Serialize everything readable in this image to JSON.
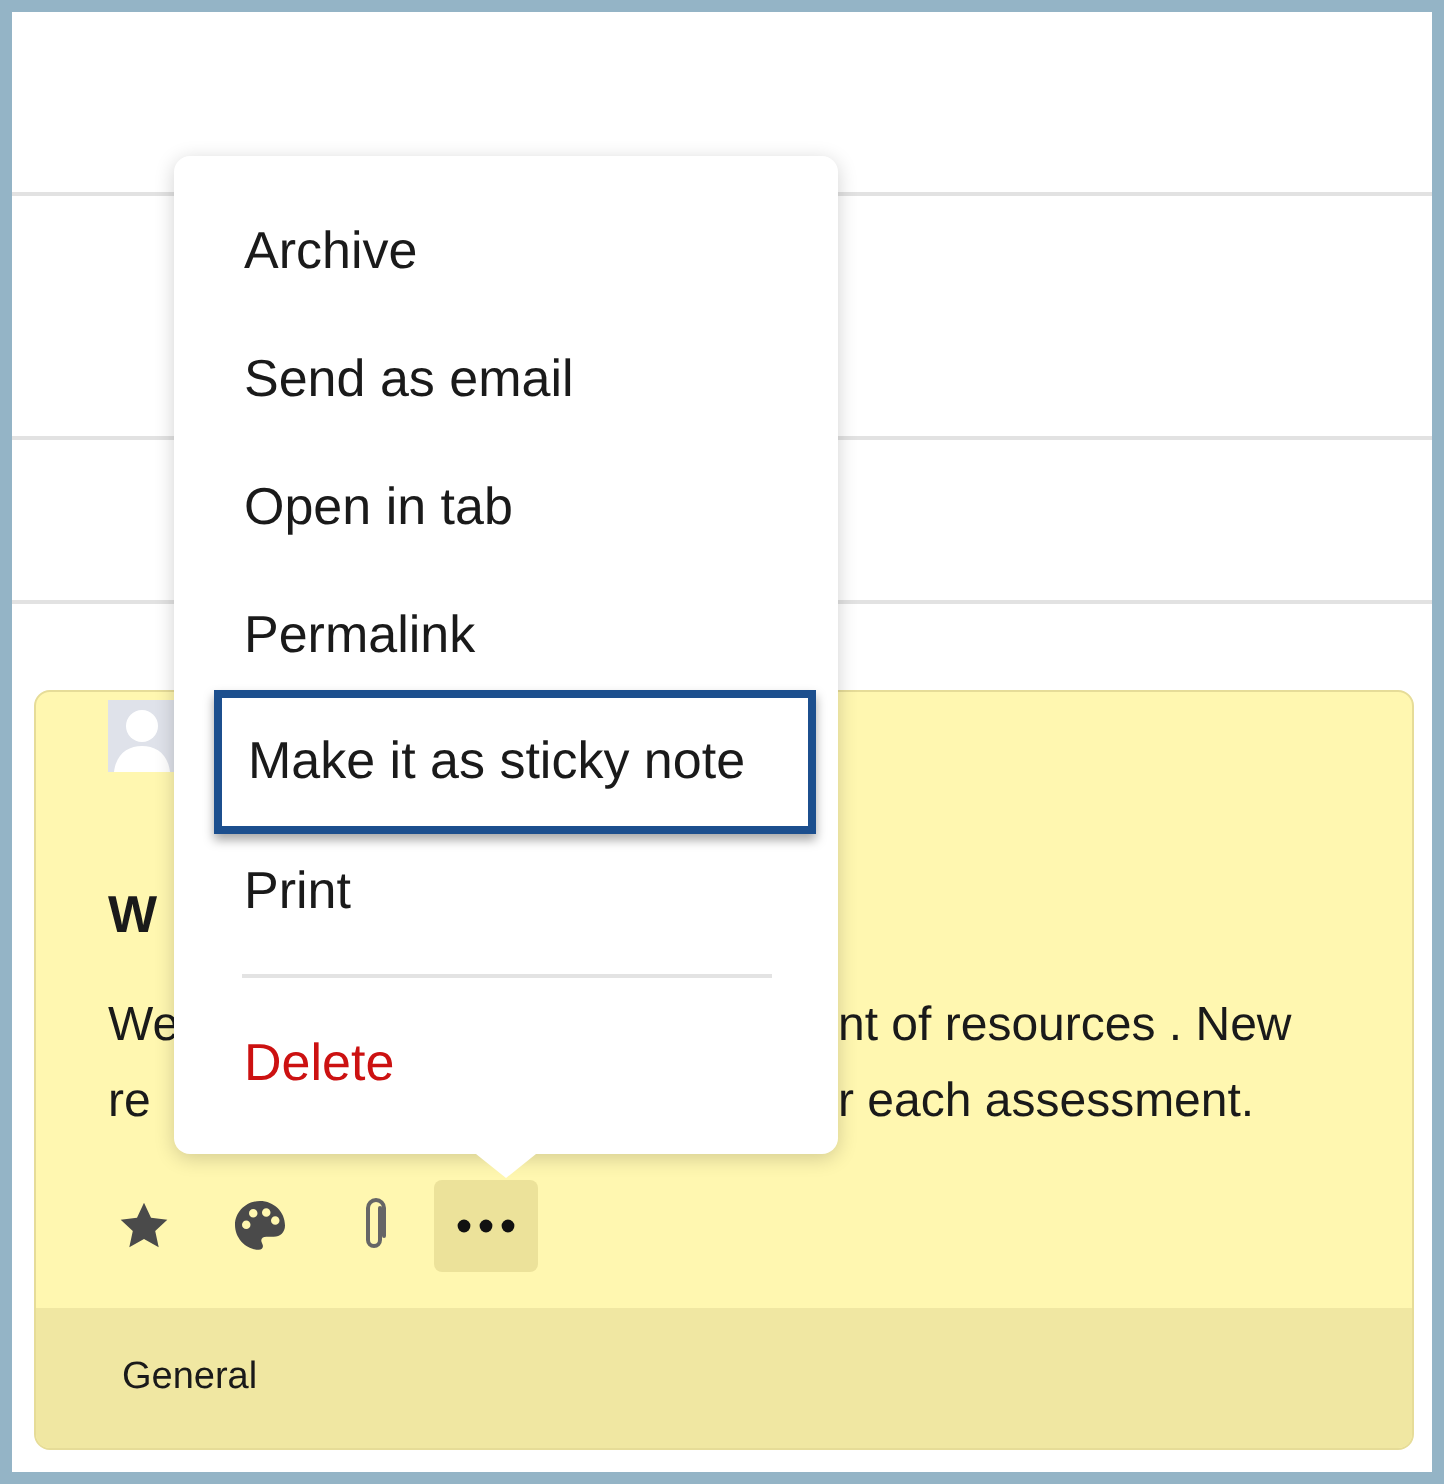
{
  "note": {
    "title": "W",
    "body_lines": [
      {
        "left": "We",
        "right": "nt of resources . New"
      },
      {
        "left": "re",
        "right": "r each assessment."
      }
    ],
    "actions": [
      {
        "kind": "star",
        "active": false
      },
      {
        "kind": "palette",
        "active": false
      },
      {
        "kind": "attach",
        "active": false
      },
      {
        "kind": "more",
        "active": true
      }
    ],
    "category": "General"
  },
  "menu": {
    "items": [
      {
        "kind": "normal",
        "label": "Archive",
        "selected": false
      },
      {
        "kind": "normal",
        "label": "Send as email",
        "selected": false
      },
      {
        "kind": "normal",
        "label": "Open in tab",
        "selected": false
      },
      {
        "kind": "normal",
        "label": "Permalink",
        "selected": false
      },
      {
        "kind": "normal",
        "label": "Make it as sticky note",
        "selected": true
      },
      {
        "kind": "normal",
        "label": "Print",
        "selected": false
      },
      {
        "kind": "separator"
      },
      {
        "kind": "danger",
        "label": "Delete",
        "selected": false
      }
    ]
  }
}
